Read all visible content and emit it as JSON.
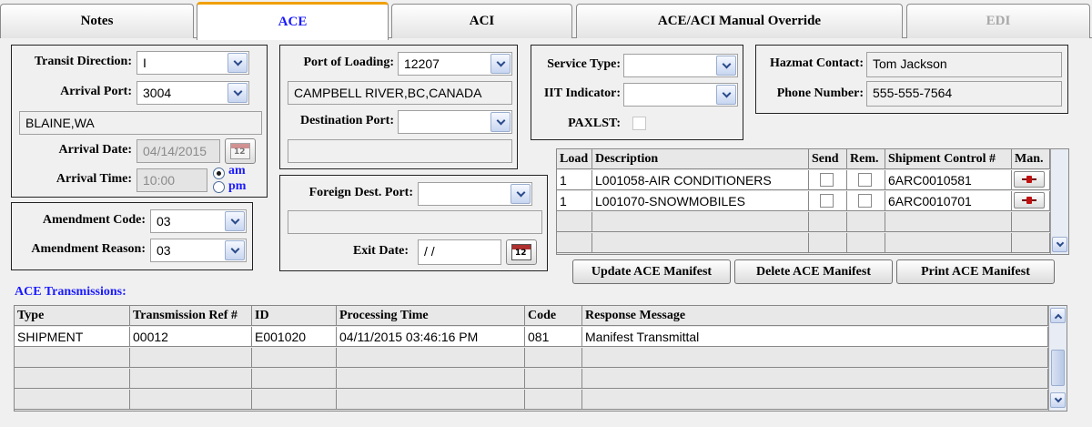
{
  "tabs": [
    {
      "label": "Notes"
    },
    {
      "label": "ACE"
    },
    {
      "label": "ACI"
    },
    {
      "label": "ACE/ACI Manual Override"
    },
    {
      "label": "EDI"
    }
  ],
  "arrival": {
    "transit_direction_label": "Transit Direction:",
    "transit_direction_value": "I",
    "arrival_port_label": "Arrival Port:",
    "arrival_port_value": "3004",
    "arrival_port_name": "BLAINE,WA",
    "arrival_date_label": "Arrival Date:",
    "arrival_date_value": "04/14/2015",
    "arrival_time_label": "Arrival Time:",
    "arrival_time_value": "10:00",
    "am_label": "am",
    "pm_label": "pm",
    "selected_period": "am"
  },
  "amendment": {
    "code_label": "Amendment Code:",
    "code_value": "03",
    "reason_label": "Amendment Reason:",
    "reason_value": "03"
  },
  "loading": {
    "port_of_loading_label": "Port of Loading:",
    "port_of_loading_value": "12207",
    "port_of_loading_name": "CAMPBELL RIVER,BC,CANADA",
    "destination_port_label": "Destination Port:",
    "destination_port_value": "",
    "destination_port_name": ""
  },
  "foreign": {
    "foreign_dest_port_label": "Foreign Dest. Port:",
    "foreign_dest_port_value": "",
    "foreign_dest_port_name": "",
    "exit_date_label": "Exit Date:",
    "exit_date_value": " / /"
  },
  "service": {
    "service_type_label": "Service Type:",
    "service_type_value": "",
    "iit_indicator_label": "IIT Indicator:",
    "iit_indicator_value": "",
    "paxlst_label": "PAXLST:",
    "paxlst_checked": false
  },
  "hazmat": {
    "contact_label": "Hazmat Contact:",
    "contact_value": "Tom Jackson",
    "phone_label": "Phone Number:",
    "phone_value": "555-555-7564"
  },
  "shipments": {
    "columns": [
      "Load",
      "Description",
      "Send",
      "Rem.",
      "Shipment Control #",
      "Man."
    ],
    "rows": [
      {
        "load": "1",
        "description": "L001058-AIR CONDITIONERS",
        "send": false,
        "rem": false,
        "control": "6ARC0010581",
        "man_icon": "pushpin-icon"
      },
      {
        "load": "1",
        "description": "L001070-SNOWMOBILES",
        "send": false,
        "rem": false,
        "control": "6ARC0010701",
        "man_icon": "pushpin-icon"
      }
    ]
  },
  "actions": {
    "update": "Update ACE Manifest",
    "delete": "Delete ACE Manifest",
    "print": "Print ACE Manifest"
  },
  "transmissions": {
    "title": "ACE Transmissions:",
    "columns": [
      "Type",
      "Transmission Ref #",
      "ID",
      "Processing Time",
      "Code",
      "Response Message"
    ],
    "rows": [
      {
        "type": "SHIPMENT",
        "ref": "00012",
        "id": "E001020",
        "time": "04/11/2015 03:46:16 PM",
        "code": "081",
        "message": "Manifest Transmittal"
      }
    ]
  },
  "colors": {
    "accent": "#1a1aff",
    "active_tab_border": "#f0a000"
  }
}
